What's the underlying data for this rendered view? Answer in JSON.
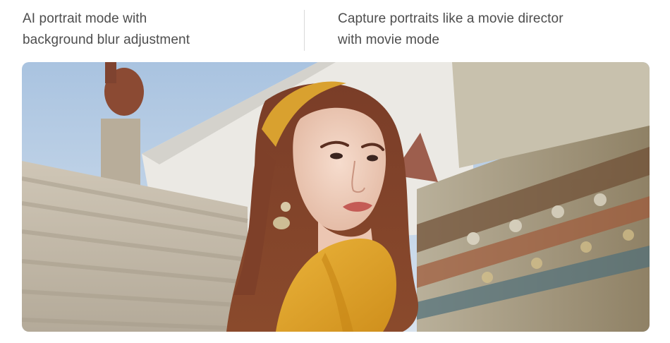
{
  "features": [
    {
      "label": "AI portrait mode with\nbackground blur adjustment"
    },
    {
      "label": "Capture portraits like a movie director\nwith movie mode"
    }
  ],
  "photo": {
    "subject": "portrait-photo",
    "colors": {
      "sky": "#b9cfe6",
      "wall": "#e8e6e1",
      "stairs": "#c9c0b1",
      "temple": "#9a8a6c",
      "hair": "#6b3424",
      "shirt": "#e2a52a",
      "headband": "#d9a12f",
      "skin": "#f2d4c3"
    }
  }
}
